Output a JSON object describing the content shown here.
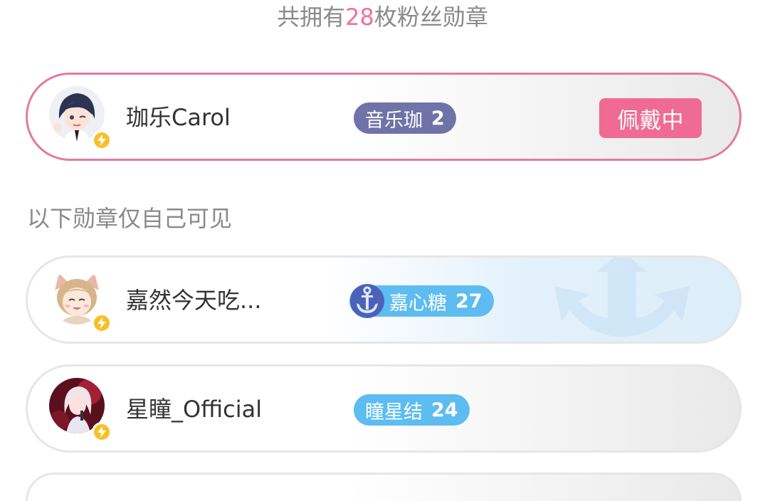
{
  "header": {
    "prefix": "共拥有",
    "count": "28",
    "suffix": "枚粉丝勋章"
  },
  "section_label": "以下勋章仅自己可见",
  "cards": [
    {
      "name": "珈乐Carol",
      "medal_name": "音乐珈",
      "medal_level": "2",
      "action_label": "佩戴中",
      "avatar_icon": "anime-girl-dark-hair-avatar",
      "badge_icon": "lightning-icon"
    },
    {
      "name": "嘉然今天吃...",
      "medal_name": "嘉心糖",
      "medal_level": "27",
      "avatar_icon": "anime-girl-cat-ears-avatar",
      "badge_icon": "lightning-icon",
      "medal_icon": "anchor-icon"
    },
    {
      "name": "星瞳_Official",
      "medal_name": "瞳星结",
      "medal_level": "24",
      "avatar_icon": "singer-girl-avatar",
      "badge_icon": "lightning-icon"
    }
  ],
  "colors": {
    "accent_pink": "#f06b93",
    "count_pink": "#f0709a",
    "medal_purple": "#6f73a8",
    "medal_blue": "#5dbcf0",
    "bolt_yellow": "#fbbf24"
  }
}
